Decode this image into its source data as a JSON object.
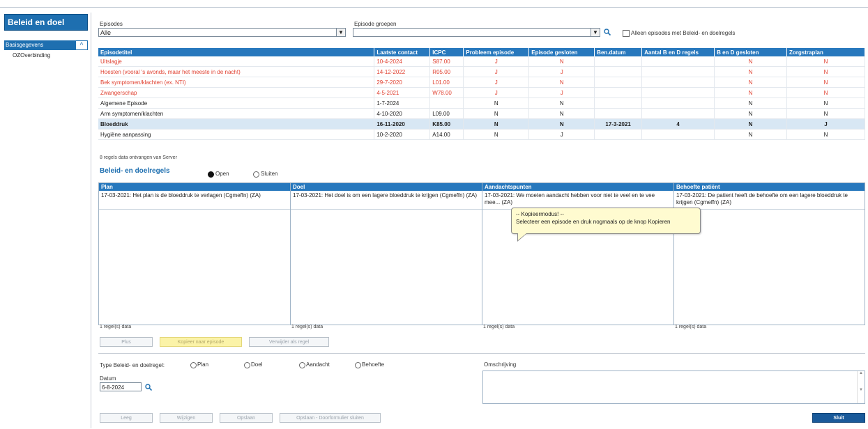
{
  "sidebar": {
    "title": "Beleid en doel",
    "group_label": "Basisgegevens",
    "item": "OZOverbinding"
  },
  "filters": {
    "episodes_label": "Episodes",
    "episodes_value": "Alle",
    "groups_label": "Episode groepen",
    "groups_value": "",
    "only_with_rules_label": "Alleen episodes met Beleid- en doelregels"
  },
  "episodes_table": {
    "headers": [
      "Episodetitel",
      "Laatste contact",
      "ICPC",
      "Probleem episode",
      "Episode gesloten",
      "Ben.datum",
      "Aantal B en D regels",
      "B en D gesloten",
      "Zorgstraplan"
    ],
    "rows": [
      {
        "style": "red",
        "cells": [
          "Uitslagje",
          "10-4-2024",
          "S87.00",
          "J",
          "N",
          "",
          "",
          "N",
          "N"
        ]
      },
      {
        "style": "red",
        "cells": [
          "Hoesten (vooral 's avonds, maar het meeste in de nacht)",
          "14-12-2022",
          "R05.00",
          "J",
          "J",
          "",
          "",
          "N",
          "N"
        ]
      },
      {
        "style": "red",
        "cells": [
          "Bek symptomen/klachten (ex. NTI)",
          "29-7-2020",
          "L01.00",
          "J",
          "N",
          "",
          "",
          "N",
          "N"
        ]
      },
      {
        "style": "red",
        "cells": [
          "Zwangerschap",
          "4-5-2021",
          "W78.00",
          "J",
          "J",
          "",
          "",
          "N",
          "N"
        ]
      },
      {
        "style": "",
        "cells": [
          "Algemene Episode",
          "1-7-2024",
          "",
          "N",
          "N",
          "",
          "",
          "N",
          "N"
        ]
      },
      {
        "style": "",
        "cells": [
          "Arm symptomen/klachten",
          "4-10-2020",
          "L09.00",
          "N",
          "N",
          "",
          "",
          "N",
          "N"
        ]
      },
      {
        "style": "selected",
        "cells": [
          "Bloeddruk",
          "16-11-2020",
          "K85.00",
          "N",
          "N",
          "17-3-2021",
          "4",
          "N",
          "J"
        ]
      },
      {
        "style": "",
        "cells": [
          "Hygiëne aanpassing",
          "10-2-2020",
          "A14.00",
          "N",
          "J",
          "",
          "",
          "N",
          "N"
        ]
      }
    ]
  },
  "status_text": "8 regels data ontvangen van Server",
  "section_title": "Beleid- en doelregels",
  "radio_open": "Open",
  "radio_closed": "Sluiten",
  "panels": [
    {
      "title": "Plan",
      "content": "17-03-2021: Het plan is de bloeddruk te verlagen (Cgmeffn) (ZA)",
      "count": "1 regel(s) data"
    },
    {
      "title": "Doel",
      "content": "17-03-2021: Het doel is om een lagere bloeddruk te krijgen (Cgmeffn) (ZA)",
      "count": "1 regel(s) data"
    },
    {
      "title": "Aandachtspunten",
      "content": "17-03-2021: We moeten aandacht hebben voor niet te veel en te vee mee... (ZA)",
      "count": "1 regel(s) data"
    },
    {
      "title": "Behoefte patiënt",
      "content": "17-03-2021: De patient heeft de behoefte om een lagere bloeddruk te krijgen (Cgmeffn) (ZA)",
      "count": "1 regel(s) data"
    }
  ],
  "tooltip": {
    "line1": "-- Kopieermodus! --",
    "line2": "Selecteer een episode en druk nogmaals op de knop Kopieren"
  },
  "mid_buttons": {
    "b1": "Plus",
    "b2": "Kopieer naar episode",
    "b3": "Verwijder als regel"
  },
  "form": {
    "type_label": "Type Beleid- en doelregel:",
    "types": [
      "Plan",
      "Doel",
      "Aandacht",
      "Behoefte"
    ],
    "description_label": "Omschrijving",
    "date_label": "Datum",
    "date_value": "6-8-2024"
  },
  "bottom_buttons": {
    "b1": "Leeg",
    "b2": "Wijzigen",
    "b3": "Opslaan",
    "b4": "Opslaan - Doorformulier sluiten",
    "ok": "Sluit"
  }
}
